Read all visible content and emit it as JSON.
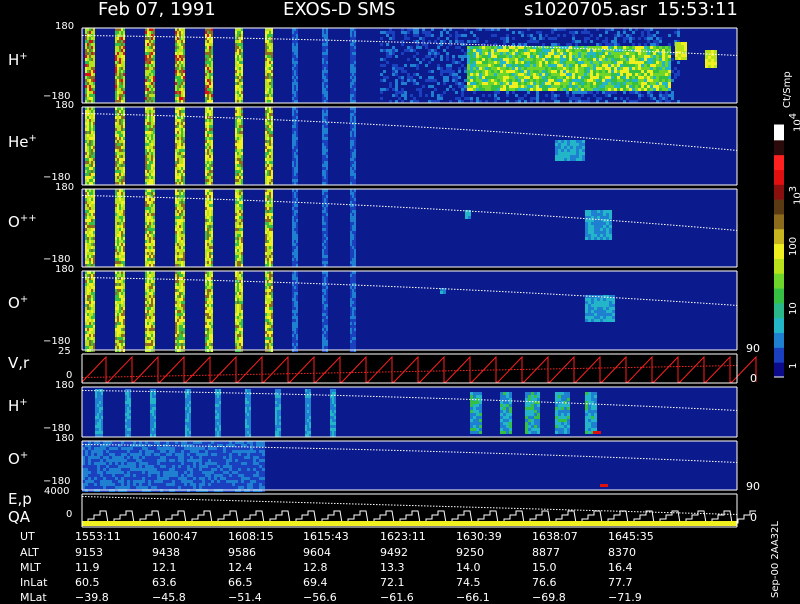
{
  "header": {
    "date": "Feb 07, 1991",
    "instrument": "EXOS-D SMS",
    "file": "s1020705.asr",
    "time": "15:53:11"
  },
  "panels": [
    {
      "id": "h",
      "label": "H",
      "sup": "+",
      "ytop": "180",
      "ybot": "−180"
    },
    {
      "id": "he",
      "label": "He",
      "sup": "+",
      "ytop": "180",
      "ybot": "−180"
    },
    {
      "id": "opp",
      "label": "O",
      "sup": "++",
      "ytop": "180",
      "ybot": "−180"
    },
    {
      "id": "o",
      "label": "O",
      "sup": "+",
      "ytop": "180",
      "ybot": "−180"
    },
    {
      "id": "vr",
      "label": "V,r",
      "sup": "",
      "ytop": "25",
      "ybot": "0"
    },
    {
      "id": "h2",
      "label": "H",
      "sup": "+",
      "ytop": "180",
      "ybot": "−180"
    },
    {
      "id": "o2",
      "label": "O",
      "sup": "+",
      "ytop": "180",
      "ybot": "−180"
    },
    {
      "id": "ep",
      "label": "E,p",
      "sup": "",
      "ytop": "4000",
      "ybot": "0"
    }
  ],
  "qa_label": "QA",
  "right_ticks": {
    "o_90": "90",
    "vr_0": "0",
    "o2_90": "90",
    "ep_0": "0"
  },
  "colorbar": {
    "unit": "Ct/Smp",
    "ticks": [
      {
        "label": "10",
        "sup": "4",
        "value": 10000
      },
      {
        "label": "10",
        "sup": "3",
        "value": 1000
      },
      {
        "label": "100",
        "sup": "",
        "value": 100
      },
      {
        "label": "10",
        "sup": "",
        "value": 10
      },
      {
        "label": "1",
        "sup": "",
        "value": 1
      }
    ],
    "colors": [
      "#0b0b8c",
      "#1a3fbf",
      "#1f7fd0",
      "#23b6c9",
      "#2ab88a",
      "#35c043",
      "#6ed52a",
      "#b8e21a",
      "#f0f020",
      "#c8b41e",
      "#8c6c1c",
      "#5a3a12",
      "#8a1010",
      "#e01010",
      "#ff2020",
      "#2a0a0a",
      "#ffffff"
    ]
  },
  "side_label": "Sep-00  2AA32L",
  "ephemeris": {
    "rows": [
      {
        "name": "UT",
        "values": [
          "1553:11",
          "1600:47",
          "1608:15",
          "1615:43",
          "1623:11",
          "1630:39",
          "1638:07",
          "1645:35"
        ]
      },
      {
        "name": "ALT",
        "values": [
          "9153",
          "9438",
          "9586",
          "9604",
          "9492",
          "9250",
          "8877",
          "8370"
        ]
      },
      {
        "name": "MLT",
        "values": [
          "11.9",
          "12.1",
          "12.4",
          "12.8",
          "13.3",
          "14.0",
          "15.0",
          "16.4"
        ]
      },
      {
        "name": "InLat",
        "values": [
          "60.5",
          "63.6",
          "66.5",
          "69.4",
          "72.1",
          "74.5",
          "76.6",
          "77.7"
        ]
      },
      {
        "name": "MLat",
        "values": [
          "−39.8",
          "−45.8",
          "−51.4",
          "−56.6",
          "−61.6",
          "−66.1",
          "−69.8",
          "−71.9"
        ]
      }
    ]
  },
  "chart_data": {
    "type": "heatmap",
    "title": "Feb 07, 1991   EXOS-D SMS",
    "x_ticks": [
      "1553:11",
      "1600:47",
      "1608:15",
      "1615:43",
      "1623:11",
      "1630:39",
      "1638:07",
      "1645:35"
    ],
    "series": [
      {
        "name": "H+",
        "ylim": [
          -180,
          180
        ]
      },
      {
        "name": "He+",
        "ylim": [
          -180,
          180
        ]
      },
      {
        "name": "O++",
        "ylim": [
          -180,
          180
        ]
      },
      {
        "name": "O+",
        "ylim": [
          -180,
          180
        ]
      },
      {
        "name": "V,r",
        "ylim": [
          0,
          25
        ]
      },
      {
        "name": "H+",
        "ylim": [
          -180,
          180
        ]
      },
      {
        "name": "O+",
        "ylim": [
          -180,
          180
        ]
      },
      {
        "name": "E,p",
        "ylim": [
          0,
          4000
        ]
      }
    ],
    "colorbar_range": [
      1,
      10000
    ],
    "colorbar_unit": "Ct/Smp"
  }
}
